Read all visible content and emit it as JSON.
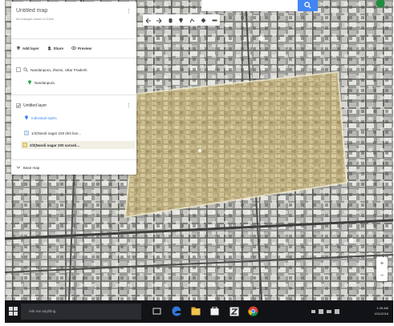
{
  "map": {
    "title": "Untitled map",
    "save_status": "All changes saved in Drive"
  },
  "toolbar": {
    "add_layer": "Add layer",
    "share": "Share",
    "preview": "Preview"
  },
  "search_result": {
    "query": "Nandanpura, Jhansi, Uttar Pradesh",
    "place": "Nandanpura"
  },
  "layer": {
    "title": "Untitled layer",
    "style_link": "Individual styles",
    "features": [
      {
        "label": "1/2(Nandi nagar 228 dmt bus..."
      },
      {
        "label": "2/2(Nandi nagar 200 sarvati..."
      }
    ],
    "base_map": "Base map"
  },
  "taskbar": {
    "search_placeholder": "Ask me anything",
    "time": "1:45 AM",
    "date": "4/11/2016"
  },
  "zoom": {
    "in": "+",
    "out": "−"
  },
  "colors": {
    "polygon_fill": "#c9b886",
    "polygon_stroke": "#f4efd2",
    "accent": "#4285f4",
    "taskbar": "#121316"
  }
}
